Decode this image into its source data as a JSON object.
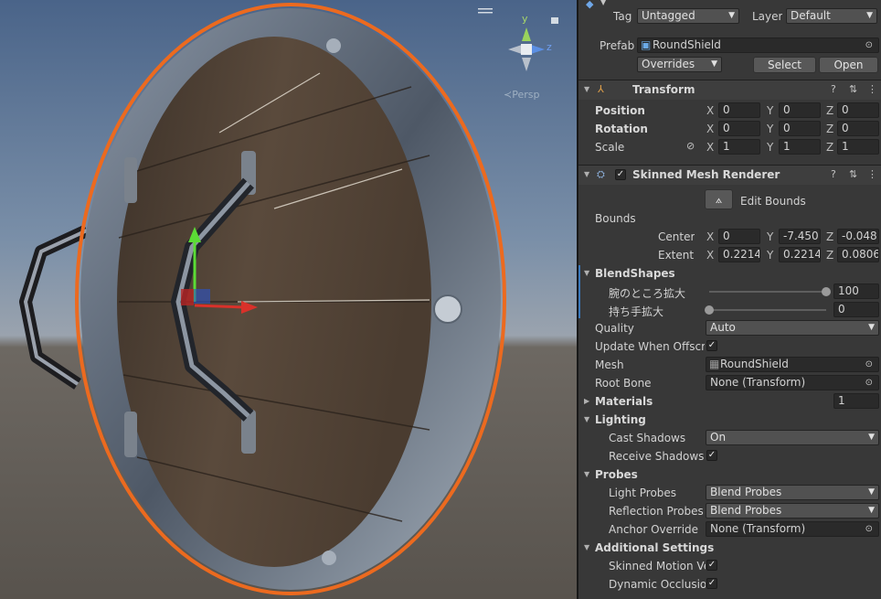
{
  "scene": {
    "persp_label": "Persp",
    "gizmo_axes": {
      "y": "y",
      "z": "z"
    }
  },
  "header": {
    "tag_label": "Tag",
    "tag_value": "Untagged",
    "layer_label": "Layer",
    "layer_value": "Default",
    "prefab_label": "Prefab",
    "prefab_value": "RoundShield",
    "overrides_label": "Overrides",
    "select_label": "Select",
    "open_label": "Open"
  },
  "transform": {
    "title": "Transform",
    "position": {
      "label": "Position",
      "x": "0",
      "y": "0",
      "z": "0"
    },
    "rotation": {
      "label": "Rotation",
      "x": "0",
      "y": "0",
      "z": "0"
    },
    "scale": {
      "label": "Scale",
      "x": "1",
      "y": "1",
      "z": "1"
    }
  },
  "axes": {
    "x": "X",
    "y": "Y",
    "z": "Z"
  },
  "smr": {
    "title": "Skinned Mesh Renderer",
    "edit_bounds": "Edit Bounds",
    "bounds_label": "Bounds",
    "center": {
      "label": "Center",
      "x": "0",
      "y": "-7.450",
      "z": "-0.048"
    },
    "extent": {
      "label": "Extent",
      "x": "0.2214",
      "y": "0.2214",
      "z": "0.0806"
    },
    "blendshapes_label": "BlendShapes",
    "blendshapes": [
      {
        "label": "腕のところ拡大",
        "value": "100",
        "level": 1.0
      },
      {
        "label": "持ち手拡大",
        "value": "0",
        "level": 0.0
      }
    ],
    "quality_label": "Quality",
    "quality_value": "Auto",
    "update_offscreen_label": "Update When Offscre",
    "mesh_label": "Mesh",
    "mesh_value": "RoundShield",
    "root_bone_label": "Root Bone",
    "root_bone_value": "None (Transform)",
    "materials_label": "Materials",
    "materials_count": "1",
    "lighting_label": "Lighting",
    "cast_shadows_label": "Cast Shadows",
    "cast_shadows_value": "On",
    "receive_shadows_label": "Receive Shadows",
    "probes_label": "Probes",
    "light_probes_label": "Light Probes",
    "light_probes_value": "Blend Probes",
    "reflection_probes_label": "Reflection Probes",
    "reflection_probes_value": "Blend Probes",
    "anchor_override_label": "Anchor Override",
    "anchor_override_value": "None (Transform)",
    "additional_label": "Additional Settings",
    "skinned_motion_label": "Skinned Motion Ve",
    "dynamic_occlusion_label": "Dynamic Occlusio"
  },
  "icons": {
    "check": "✓",
    "fold_open": "▼",
    "fold_closed": "▶",
    "dropdown": "▼",
    "target": "⊙",
    "help": "?",
    "settings": "⋮"
  }
}
